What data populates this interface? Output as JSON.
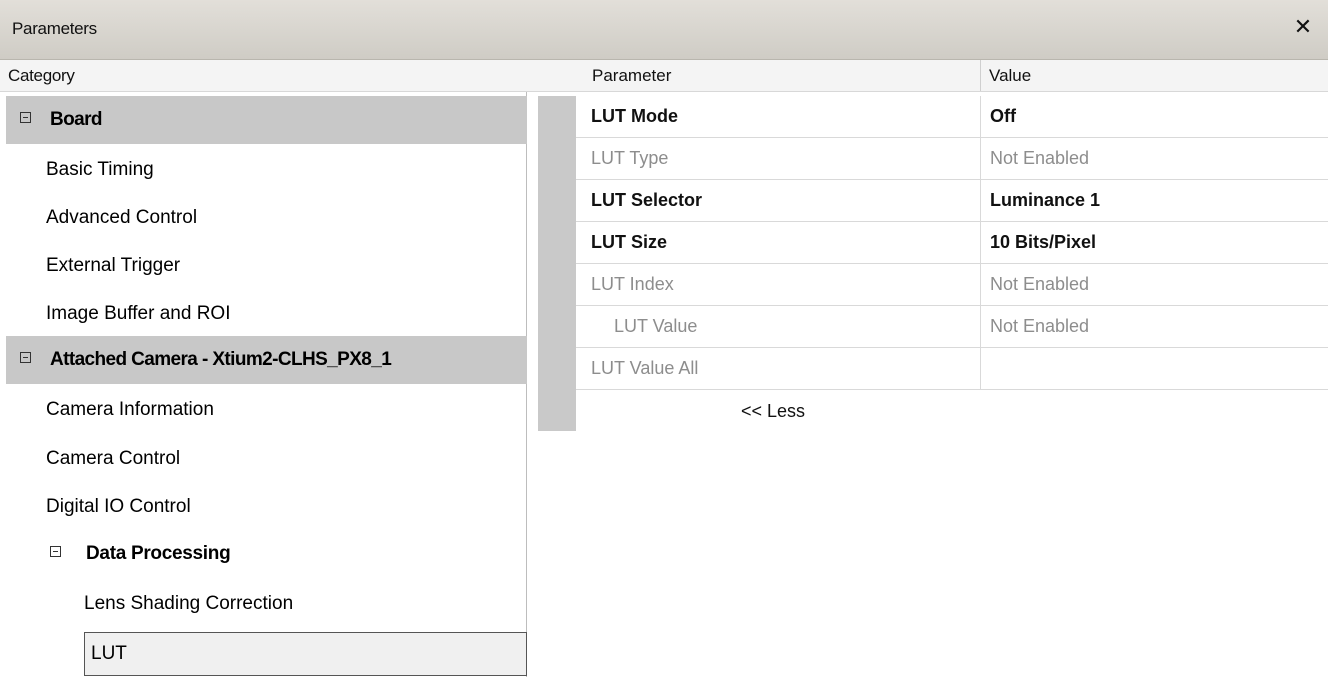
{
  "window": {
    "title": "Parameters",
    "close_glyph": "✕"
  },
  "columns": {
    "category": "Category",
    "parameter": "Parameter",
    "value": "Value"
  },
  "categories": [
    {
      "label": "Board",
      "type": "group",
      "expanded": true
    },
    {
      "label": "Basic Timing",
      "type": "item"
    },
    {
      "label": "Advanced Control",
      "type": "item"
    },
    {
      "label": "External Trigger",
      "type": "item"
    },
    {
      "label": "Image Buffer and ROI",
      "type": "item"
    },
    {
      "label": "Attached Camera - Xtium2-CLHS_PX8_1",
      "type": "group",
      "expanded": true
    },
    {
      "label": "Camera Information",
      "type": "item"
    },
    {
      "label": "Camera Control",
      "type": "item"
    },
    {
      "label": "Digital IO Control",
      "type": "item"
    },
    {
      "label": "Data Processing",
      "type": "subgroup",
      "expanded": true
    },
    {
      "label": "Lens Shading Correction",
      "type": "subitem"
    },
    {
      "label": "LUT",
      "type": "subitem",
      "selected": true
    }
  ],
  "parameters": [
    {
      "name": "LUT Mode",
      "value": "Off",
      "enabled": true
    },
    {
      "name": "LUT Type",
      "value": "Not Enabled",
      "enabled": false
    },
    {
      "name": "LUT Selector",
      "value": "Luminance 1",
      "enabled": true
    },
    {
      "name": "LUT Size",
      "value": "10 Bits/Pixel",
      "enabled": true
    },
    {
      "name": "LUT Index",
      "value": "Not Enabled",
      "enabled": false
    },
    {
      "name": "LUT Value",
      "value": "Not Enabled",
      "enabled": false,
      "indent": true
    },
    {
      "name": "LUT Value All",
      "value": "",
      "enabled": false
    }
  ],
  "less_link": "<< Less",
  "colors": {
    "group_row_bg": "#c8c8c8",
    "disabled_text": "#8d8d8d",
    "titlebar_bg": "#d8d5cf"
  }
}
